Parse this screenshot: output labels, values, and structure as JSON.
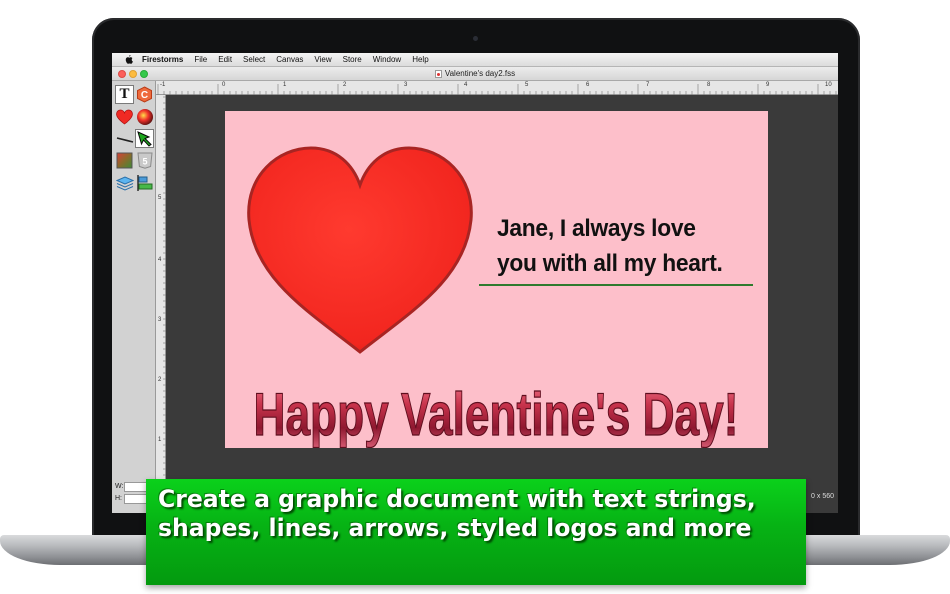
{
  "menubar": {
    "app_name": "Firestorms",
    "items": [
      "File",
      "Edit",
      "Select",
      "Canvas",
      "View",
      "Store",
      "Window",
      "Help"
    ]
  },
  "window": {
    "title": "Valentine's day2.fss"
  },
  "tools": [
    {
      "icon": "text-tool-icon",
      "glyph": "T"
    },
    {
      "icon": "logo-tool-icon",
      "glyph": "C"
    },
    {
      "icon": "heart-shape-tool-icon"
    },
    {
      "icon": "color-wheel-tool-icon"
    },
    {
      "icon": "line-tool-icon"
    },
    {
      "icon": "arrow-tool-icon"
    },
    {
      "icon": "image-tool-icon"
    },
    {
      "icon": "html5-tool-icon",
      "glyph": "5"
    },
    {
      "icon": "layers-tool-icon"
    },
    {
      "icon": "align-tool-icon"
    }
  ],
  "dimension_fields": {
    "w_label": "W:",
    "h_label": "H:"
  },
  "ruler": {
    "top_numbers": [
      "-1",
      "0",
      "1",
      "2",
      "3",
      "4",
      "5",
      "6",
      "7",
      "8",
      "9",
      "10"
    ],
    "left_numbers": [
      "5",
      "4",
      "3",
      "2",
      "1"
    ]
  },
  "canvas": {
    "background": "#fdbfca",
    "message_lines": [
      "Jane, I always love",
      "you with all my heart."
    ],
    "headline": "Happy Valentine's Day!",
    "heart_color": "#f52a24",
    "underline_color": "#2e7a2e"
  },
  "status": {
    "canvas_size": "0 x 560"
  },
  "banner": {
    "lines": [
      "Create a graphic document with text strings,",
      "shapes, lines, arrows, styled logos and more"
    ],
    "color": "#06b214"
  }
}
